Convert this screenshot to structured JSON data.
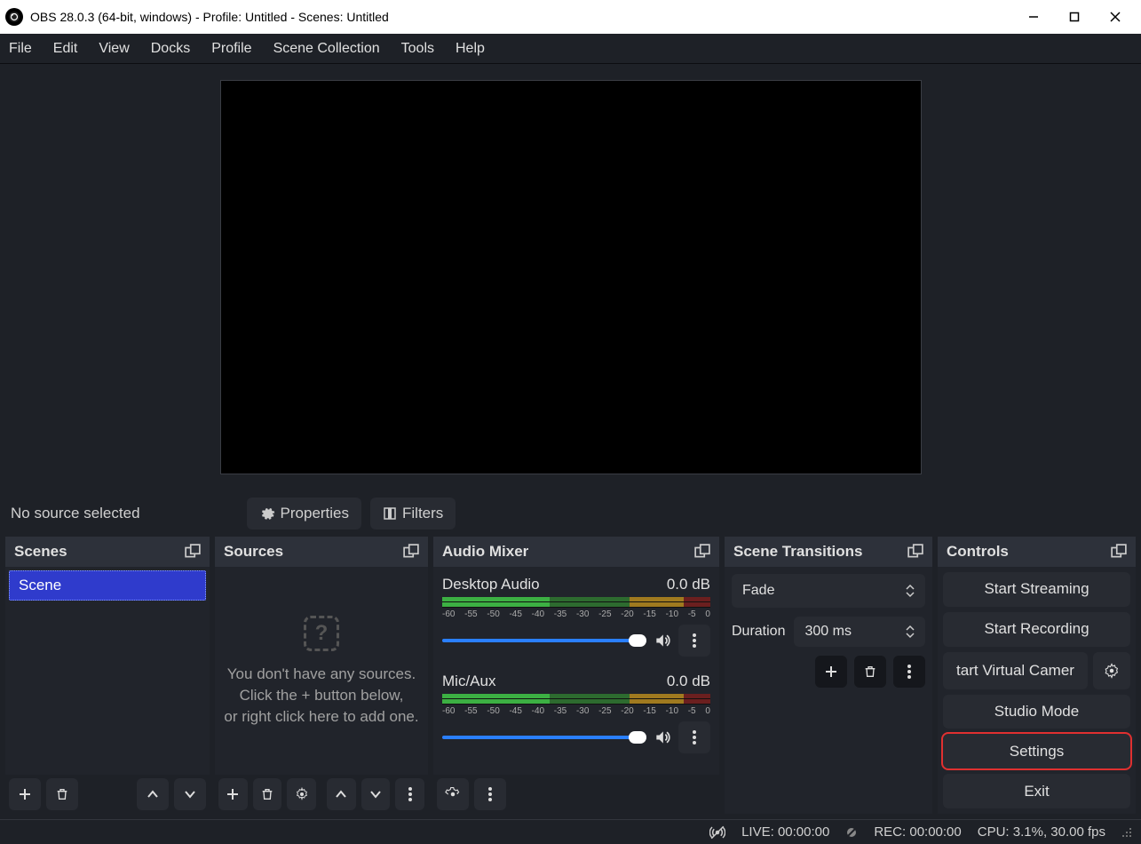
{
  "titlebar": {
    "title": "OBS 28.0.3 (64-bit, windows) - Profile: Untitled - Scenes: Untitled"
  },
  "menubar": {
    "items": [
      "File",
      "Edit",
      "View",
      "Docks",
      "Profile",
      "Scene Collection",
      "Tools",
      "Help"
    ]
  },
  "sourceToolbar": {
    "noSource": "No source selected",
    "properties": "Properties",
    "filters": "Filters"
  },
  "docks": {
    "scenes": {
      "title": "Scenes",
      "items": [
        "Scene"
      ]
    },
    "sources": {
      "title": "Sources",
      "emptyLine1": "You don't have any sources.",
      "emptyLine2": "Click the + button below,",
      "emptyLine3": "or right click here to add one."
    },
    "mixer": {
      "title": "Audio Mixer",
      "channels": [
        {
          "name": "Desktop Audio",
          "level": "0.0 dB"
        },
        {
          "name": "Mic/Aux",
          "level": "0.0 dB"
        }
      ],
      "ticks": [
        "-60",
        "-55",
        "-50",
        "-45",
        "-40",
        "-35",
        "-30",
        "-25",
        "-20",
        "-15",
        "-10",
        "-5",
        "0"
      ]
    },
    "transitions": {
      "title": "Scene Transitions",
      "selected": "Fade",
      "durationLabel": "Duration",
      "durationValue": "300 ms"
    },
    "controls": {
      "title": "Controls",
      "buttons": {
        "startStreaming": "Start Streaming",
        "startRecording": "Start Recording",
        "startVirtualCam": "tart Virtual Camer",
        "studioMode": "Studio Mode",
        "settings": "Settings",
        "exit": "Exit"
      }
    }
  },
  "statusbar": {
    "live": "LIVE: 00:00:00",
    "rec": "REC: 00:00:00",
    "cpu": "CPU: 3.1%, 30.00 fps"
  }
}
